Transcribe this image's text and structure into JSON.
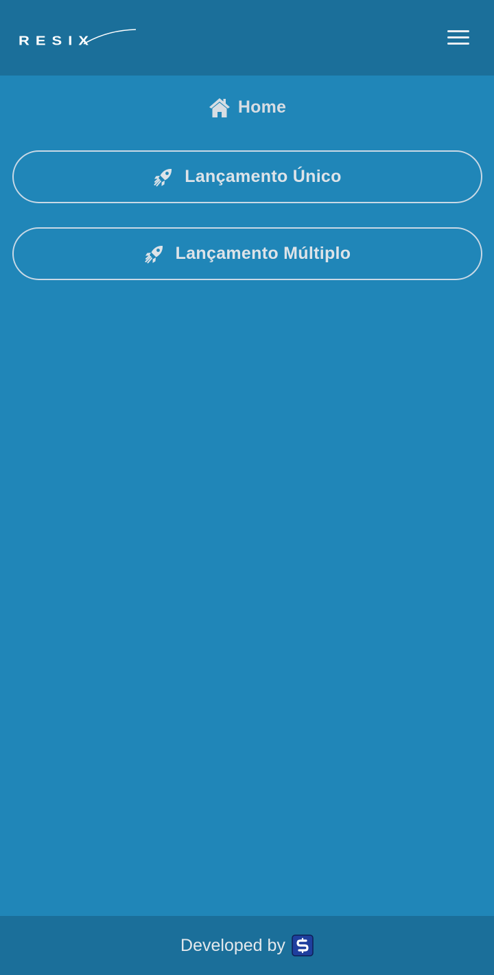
{
  "header": {
    "logo_text": "RESIX",
    "menu_icon": "hamburger-menu-icon"
  },
  "page": {
    "title": "Home",
    "title_icon": "home-icon"
  },
  "actions": [
    {
      "label": "Lançamento Único",
      "icon": "rocket-icon"
    },
    {
      "label": "Lançamento Múltiplo",
      "icon": "rocket-icon"
    }
  ],
  "footer": {
    "text": "Developed by",
    "logo_icon": "developer-logo-icon"
  },
  "colors": {
    "background": "#2086b8",
    "header_footer": "#1b6f9a",
    "text_light": "#d7dde3",
    "button_border": "#c9d9e6",
    "dev_logo_bg": "#1f3f9e"
  }
}
